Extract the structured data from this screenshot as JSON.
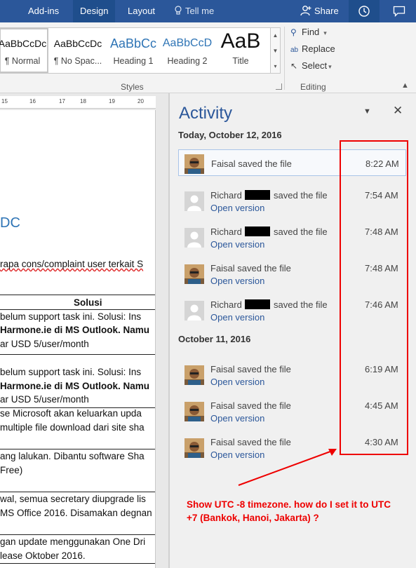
{
  "ribbon_tabs": [
    "Add-ins",
    "Design",
    "Layout"
  ],
  "tell_me": "Tell me",
  "share_label": "Share",
  "styles": [
    {
      "preview": "AaBbCcDc",
      "name": "¶ Normal"
    },
    {
      "preview": "AaBbCcDc",
      "name": "¶ No Spac..."
    },
    {
      "preview": "AaBbCc",
      "name": "Heading 1"
    },
    {
      "preview": "AaBbCcD",
      "name": "Heading 2"
    },
    {
      "preview": "AaB",
      "name": "Title"
    }
  ],
  "styles_group_label": "Styles",
  "editing": {
    "find": "Find",
    "replace": "Replace",
    "select": "Select",
    "group_label": "Editing"
  },
  "ruler_numbers": [
    "15",
    "16",
    "17",
    "18",
    "19",
    "20"
  ],
  "doc": {
    "title_fragment": "DC",
    "line1": "rapa cons/complaint user terkait S",
    "solusi_header": "Solusi",
    "rows": [
      {
        "l1": "belum support task ini. Solusi: Ins",
        "l2": "Harmone.ie di MS Outlook. Namu",
        "l3": "ar USD 5/user/month"
      },
      {
        "l1": "belum support task ini. Solusi: Ins",
        "l2": "Harmone.ie di MS Outlook. Namu",
        "l3": "ar USD 5/user/month"
      }
    ],
    "line_a": "se Microsoft akan keluarkan upda",
    "line_b": "multiple file download dari site sha",
    "line_c": "ang lalukan. Dibantu software Sha",
    "line_d": "Free)",
    "line_e": "wal, semua secretary diupgrade lis",
    "line_f": "MS Office 2016. Disamakan degnan",
    "line_g": "gan update menggunakan One Dri",
    "line_h": "lease Oktober 2016."
  },
  "activity": {
    "title": "Activity",
    "groups": [
      {
        "date": "Today, October 12, 2016",
        "entries": [
          {
            "who": "Faisal saved the file",
            "time": "8:22 AM",
            "open": "",
            "avatar": "photo"
          },
          {
            "who_pre": "Richard",
            "who_post": "saved the file",
            "time": "7:54 AM",
            "open": "Open version",
            "avatar": "generic"
          },
          {
            "who_pre": "Richard",
            "who_post": "saved the file",
            "time": "7:48 AM",
            "open": "Open version",
            "avatar": "generic"
          },
          {
            "who": "Faisal saved the file",
            "time": "7:48 AM",
            "open": "Open version",
            "avatar": "photo"
          },
          {
            "who_pre": "Richard",
            "who_post": "saved the file",
            "time": "7:46 AM",
            "open": "Open version",
            "avatar": "generic"
          }
        ]
      },
      {
        "date": "October 11, 2016",
        "entries": [
          {
            "who": "Faisal saved the file",
            "time": "6:19 AM",
            "open": "Open version",
            "avatar": "photo"
          },
          {
            "who": "Faisal saved the file",
            "time": "4:45 AM",
            "open": "Open version",
            "avatar": "photo"
          },
          {
            "who": "Faisal saved the file",
            "time": "4:30 AM",
            "open": "Open version",
            "avatar": "photo"
          }
        ]
      }
    ]
  },
  "annotation": "Show UTC -8 timezone. how do I set it to UTC +7 (Bankok, Hanoi, Jakarta) ?",
  "colors": {
    "word_blue": "#2b579a",
    "annotation_red": "#e00000",
    "link_blue": "#2b579a"
  }
}
